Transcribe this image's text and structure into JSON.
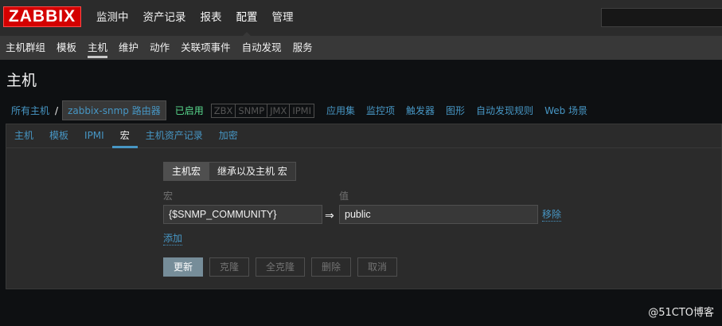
{
  "logo": "ZABBIX",
  "main_menu": [
    {
      "label": "监测中"
    },
    {
      "label": "资产记录"
    },
    {
      "label": "报表"
    },
    {
      "label": "配置"
    },
    {
      "label": "管理"
    }
  ],
  "sub_menu": [
    {
      "label": "主机群组"
    },
    {
      "label": "模板"
    },
    {
      "label": "主机"
    },
    {
      "label": "维护"
    },
    {
      "label": "动作"
    },
    {
      "label": "关联项事件"
    },
    {
      "label": "自动发现"
    },
    {
      "label": "服务"
    }
  ],
  "page_title": "主机",
  "breadcrumb": {
    "all_hosts": "所有主机",
    "separator": "/",
    "current_host": "zabbix-snmp 路由器",
    "status": "已启用",
    "availability": [
      "ZBX",
      "SNMP",
      "JMX",
      "IPMI"
    ],
    "links": [
      "应用集",
      "监控项",
      "触发器",
      "图形",
      "自动发现规则",
      "Web 场景"
    ]
  },
  "tabs": [
    {
      "label": "主机"
    },
    {
      "label": "模板"
    },
    {
      "label": "IPMI"
    },
    {
      "label": "宏"
    },
    {
      "label": "主机资产记录"
    },
    {
      "label": "加密"
    }
  ],
  "macro_toggle": {
    "host_macros": "主机宏",
    "inherited": "继承以及主机 宏"
  },
  "columns": {
    "macro": "宏",
    "value": "值"
  },
  "macro_row": {
    "macro": "{$SNMP_COMMUNITY}",
    "arrow": "⇒",
    "value": "public",
    "remove": "移除"
  },
  "add_link": "添加",
  "buttons": {
    "update": "更新",
    "clone": "克隆",
    "full_clone": "全克隆",
    "delete": "删除",
    "cancel": "取消"
  },
  "watermark": "@51CTO博客",
  "colors": {
    "brand": "#d40000",
    "link": "#4796c4",
    "enabled": "#59db8f",
    "primary_button": "#768d99"
  }
}
